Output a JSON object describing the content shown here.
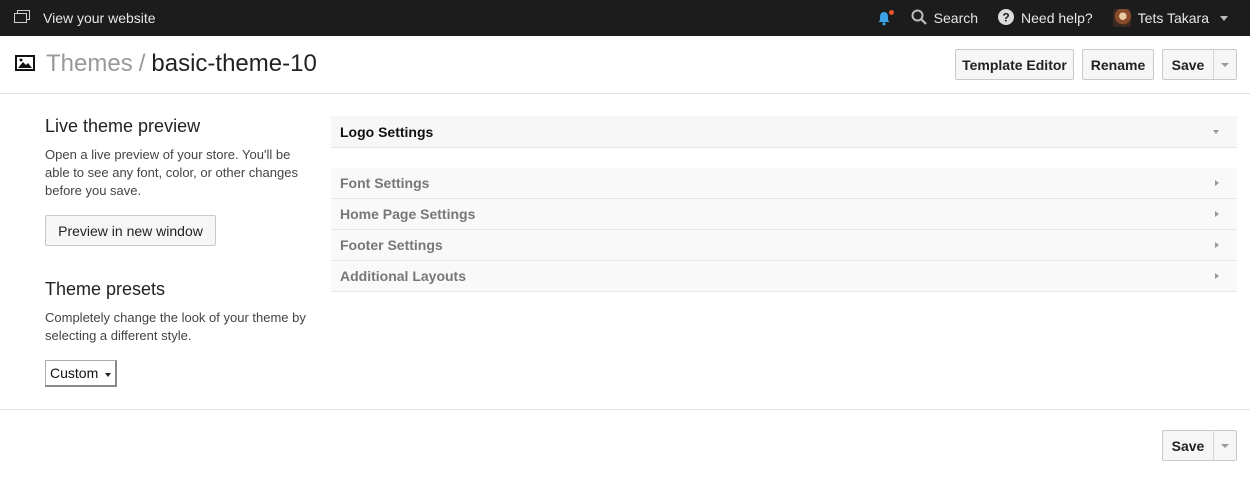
{
  "topbar": {
    "site_link": "View your website",
    "search": "Search",
    "help": "Need help?",
    "user": "Tets Takara"
  },
  "header": {
    "crumb": "Themes",
    "separator": "/",
    "current": "basic-theme-10",
    "template_editor": "Template Editor",
    "rename": "Rename",
    "save": "Save"
  },
  "preview": {
    "title": "Live theme preview",
    "description": "Open a live preview of your store. You'll be able to see any font, color, or other changes before you save.",
    "button": "Preview in new window"
  },
  "presets": {
    "title": "Theme presets",
    "description": "Completely change the look of your theme by selecting a different style.",
    "selected": "Custom"
  },
  "settings": {
    "sections": [
      "Logo Settings",
      "Font Settings",
      "Home Page Settings",
      "Footer Settings",
      "Additional Layouts"
    ]
  },
  "footer": {
    "save": "Save"
  }
}
